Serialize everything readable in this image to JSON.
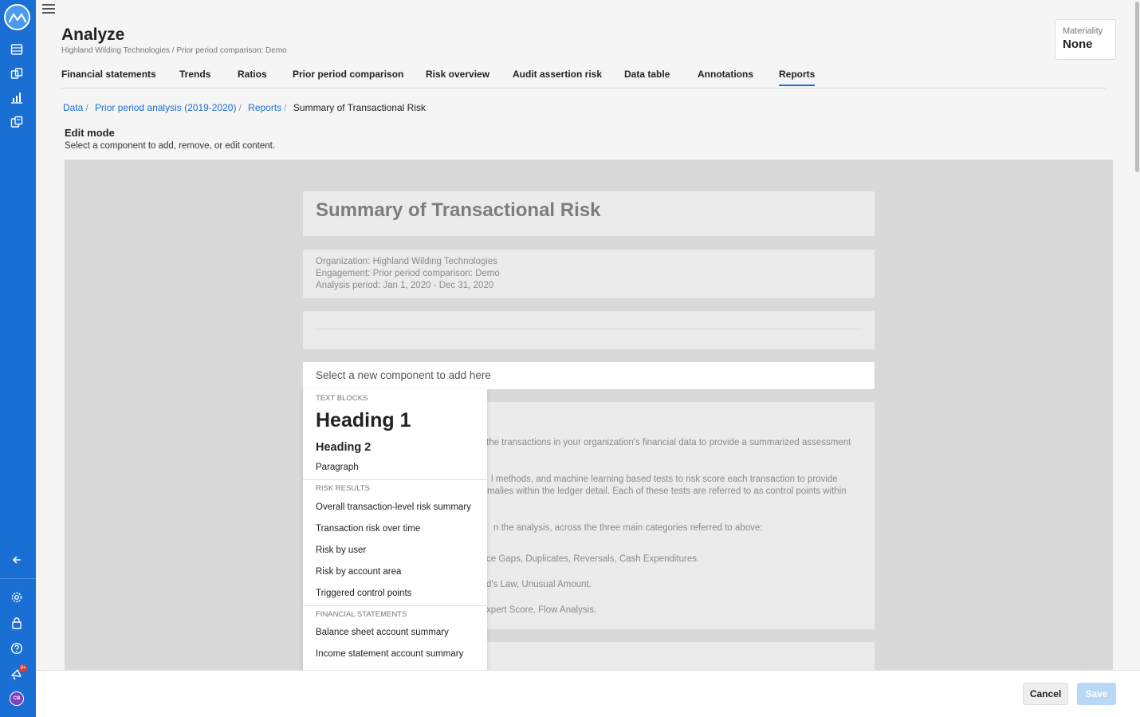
{
  "app": {
    "title": "Analyze",
    "subtitle": "Highland Wilding Technologies / Prior period comparison: Demo"
  },
  "materiality": {
    "label": "Materiality",
    "value": "None"
  },
  "tabs": [
    {
      "label": "Financial statements"
    },
    {
      "label": "Trends"
    },
    {
      "label": "Ratios"
    },
    {
      "label": "Prior period comparison"
    },
    {
      "label": "Risk overview"
    },
    {
      "label": "Audit assertion risk"
    },
    {
      "label": "Data table"
    },
    {
      "label": "Annotations"
    },
    {
      "label": "Reports",
      "active": true
    }
  ],
  "breadcrumb": [
    "Data",
    "Prior period analysis (2019-2020)",
    "Reports",
    "Summary of Transactional Risk"
  ],
  "edit": {
    "title": "Edit mode",
    "description": "Select a component to add, remove, or edit content."
  },
  "report": {
    "title": "Summary of Transactional Risk",
    "info": [
      "Organization: Highland Wilding Technologies",
      "Engagement: Prior period comparison: Demo",
      "Analysis period: Jan 1, 2020 - Dec 31, 2020"
    ],
    "add_placeholder": "Select a new component to add here",
    "body_fragments": [
      "the transactions in your organization's financial data to provide a summarized assessment",
      "l methods, and machine learning based tests to risk score each transaction to provide",
      "malies within the ledger detail. Each of these tests are referred to as control points within",
      "n the analysis, across the three main categories referred to above:",
      "ce Gaps, Duplicates, Reversals, Cash Expenditures.",
      "d's Law, Unusual Amount.",
      "xpert Score, Flow Analysis."
    ]
  },
  "dropdown": {
    "text_blocks": {
      "label": "TEXT BLOCKS",
      "heading1": "Heading 1",
      "heading2": "Heading 2",
      "paragraph": "Paragraph"
    },
    "risk_results": {
      "label": "RISK RESULTS",
      "items": [
        "Overall transaction-level risk summary",
        "Transaction risk over time",
        "Risk by user",
        "Risk by account area",
        "Triggered control points"
      ]
    },
    "financial_statements": {
      "label": "FINANCIAL STATEMENTS",
      "items": [
        "Balance sheet account summary",
        "Income statement account summary"
      ]
    }
  },
  "footer": {
    "cancel": "Cancel",
    "save": "Save"
  },
  "user": {
    "initials": "CB",
    "notification_badge": "9+"
  },
  "colors": {
    "brand": "#1a6fd4",
    "rail": "#1a6fd4",
    "save_disabled": "#b8d8f5",
    "badge": "#e53935",
    "avatar": "#7b3fb8"
  }
}
